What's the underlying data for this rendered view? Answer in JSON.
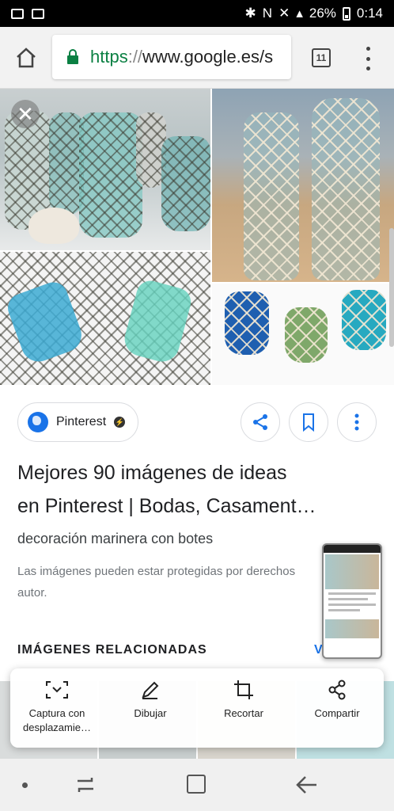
{
  "status_bar": {
    "battery": "26%",
    "time": "0:14"
  },
  "browser": {
    "url_scheme": "https",
    "url_sep": "://",
    "url_host": "www.google.es/s",
    "tab_count": "11"
  },
  "result": {
    "source": "Pinterest",
    "title_line1": "Mejores 90 imágenes de ideas",
    "title_line2": "en Pinterest | Bodas, Casament…",
    "subtitle": "decoración marinera con botes",
    "copyright_line1": "Las imágenes pueden estar protegidas por derechos",
    "copyright_line2": "autor."
  },
  "related": {
    "header": "IMÁGENES RELACIONADAS",
    "more": "V"
  },
  "capture_toolbar": {
    "items": [
      {
        "label": "Captura con desplazamie…",
        "icon": "scroll-capture-icon"
      },
      {
        "label": "Dibujar",
        "icon": "pen-icon"
      },
      {
        "label": "Recortar",
        "icon": "crop-icon"
      },
      {
        "label": "Compartir",
        "icon": "share-icon"
      }
    ]
  },
  "colors": {
    "accent": "#1a73e8",
    "lock": "#0b8043"
  }
}
